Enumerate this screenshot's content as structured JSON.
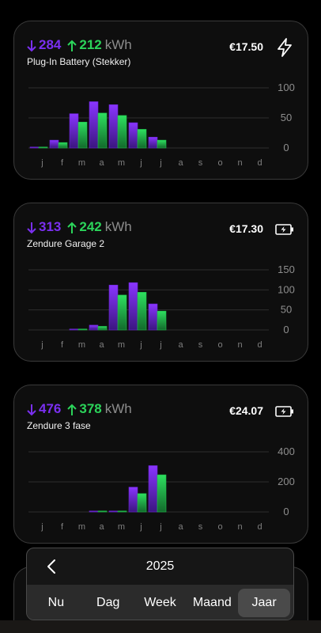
{
  "months": [
    "j",
    "f",
    "m",
    "a",
    "m",
    "j",
    "j",
    "a",
    "s",
    "o",
    "n",
    "d"
  ],
  "colors": {
    "consumed": "#7a2ff0",
    "produced": "#2bd45a"
  },
  "cards": [
    {
      "consumed": "284",
      "produced": "212",
      "unit": "kWh",
      "title": "Plug-In Battery (Stekker)",
      "price": "€17.50",
      "icon": "lightning-icon",
      "chart_data": {
        "type": "bar",
        "categories": [
          "j",
          "f",
          "m",
          "a",
          "m",
          "j",
          "j",
          "a",
          "s",
          "o",
          "n",
          "d"
        ],
        "ylim": [
          0,
          100
        ],
        "yticks": [
          "100",
          "50",
          "0"
        ],
        "series": [
          {
            "values": [
              1,
              13,
              57,
              77,
              72,
              42,
              18,
              0,
              0,
              0,
              0,
              0
            ]
          },
          {
            "values": [
              1,
              9,
              43,
              58,
              54,
              31,
              13,
              0,
              0,
              0,
              0,
              0
            ]
          }
        ]
      }
    },
    {
      "consumed": "313",
      "produced": "242",
      "unit": "kWh",
      "title": "Zendure Garage 2",
      "price": "€17.30",
      "icon": "battery-charging-icon",
      "chart_data": {
        "type": "bar",
        "categories": [
          "j",
          "f",
          "m",
          "a",
          "m",
          "j",
          "j",
          "a",
          "s",
          "o",
          "n",
          "d"
        ],
        "ylim": [
          0,
          150
        ],
        "yticks": [
          "150",
          "100",
          "50",
          "0"
        ],
        "series": [
          {
            "values": [
              0,
              0,
              2,
              12,
              112,
              118,
              65,
              0,
              0,
              0,
              0,
              0
            ]
          },
          {
            "values": [
              0,
              0,
              1,
              9,
              87,
              94,
              47,
              0,
              0,
              0,
              0,
              0
            ]
          }
        ]
      }
    },
    {
      "consumed": "476",
      "produced": "378",
      "unit": "kWh",
      "title": "Zendure 3 fase",
      "price": "€24.07",
      "icon": "battery-charging-icon",
      "chart_data": {
        "type": "bar",
        "categories": [
          "j",
          "f",
          "m",
          "a",
          "m",
          "j",
          "j",
          "a",
          "s",
          "o",
          "n",
          "d"
        ],
        "ylim": [
          0,
          400
        ],
        "yticks": [
          "400",
          "200",
          "0"
        ],
        "series": [
          {
            "values": [
              0,
              0,
              0,
              2,
              2,
              165,
              308,
              0,
              0,
              0,
              0,
              0
            ]
          },
          {
            "values": [
              0,
              0,
              0,
              1,
              1,
              122,
              247,
              0,
              0,
              0,
              0,
              0
            ]
          }
        ]
      }
    }
  ],
  "picker": {
    "year": "2025",
    "tabs": [
      "Nu",
      "Dag",
      "Week",
      "Maand",
      "Jaar"
    ],
    "active_tab": "Jaar"
  }
}
